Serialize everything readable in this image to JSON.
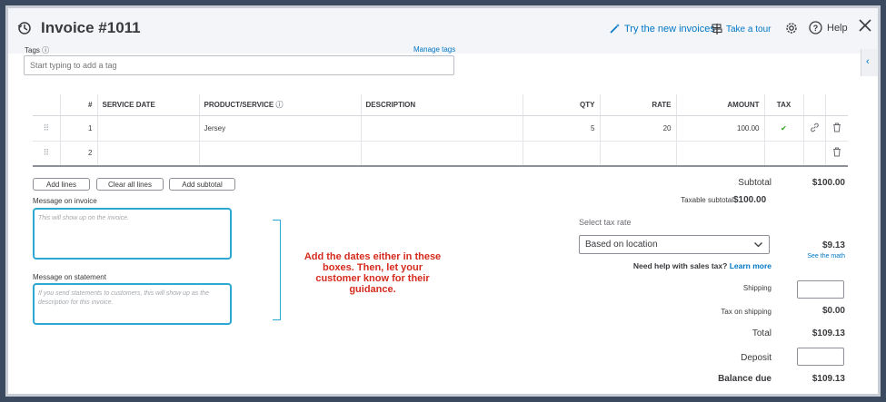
{
  "header": {
    "title": "Invoice #1011",
    "try_new": "Try the new invoices",
    "take_tour": "Take a tour",
    "help": "Help"
  },
  "tags": {
    "label": "Tags",
    "manage": "Manage tags",
    "placeholder": "Start typing to add a tag"
  },
  "table": {
    "columns": [
      "#",
      "SERVICE DATE",
      "PRODUCT/SERVICE",
      "DESCRIPTION",
      "QTY",
      "RATE",
      "AMOUNT",
      "TAX"
    ],
    "rows": [
      {
        "num": "1",
        "service_date": "",
        "product": "Jersey",
        "description": "",
        "qty": "5",
        "rate": "20",
        "amount": "100.00",
        "tax": "✔"
      },
      {
        "num": "2",
        "service_date": "",
        "product": "",
        "description": "",
        "qty": "",
        "rate": "",
        "amount": "",
        "tax": ""
      }
    ]
  },
  "buttons": {
    "add_lines": "Add lines",
    "clear_all": "Clear all lines",
    "add_subtotal": "Add subtotal"
  },
  "message_invoice": {
    "label": "Message on invoice",
    "placeholder": "This will show up on the invoice."
  },
  "message_statement": {
    "label": "Message on statement",
    "placeholder": "If you send statements to customers, this will show up as the description for this invoice."
  },
  "annotation": "Add the dates either in these boxes. Then, let your customer know for their guidance.",
  "summary": {
    "subtotal_label": "Subtotal",
    "subtotal_value": "$100.00",
    "taxable_label": "Taxable subtotal",
    "taxable_value": "$100.00",
    "select_tax_label": "Select tax rate",
    "tax_rate_value": "Based on location",
    "tax_amount": "$9.13",
    "see_math": "See the math",
    "need_help": "Need help with sales tax?",
    "learn_more": "Learn more",
    "shipping_label": "Shipping",
    "tax_on_shipping_label": "Tax on shipping",
    "tax_on_shipping_value": "$0.00",
    "total_label": "Total",
    "total_value": "$109.13",
    "deposit_label": "Deposit",
    "balance_label": "Balance due",
    "balance_value": "$109.13"
  },
  "colors": {
    "accent": "#0077c5",
    "highlight": "#2ca8d2",
    "annotation": "#d52b1e",
    "check": "#2ca01c"
  }
}
